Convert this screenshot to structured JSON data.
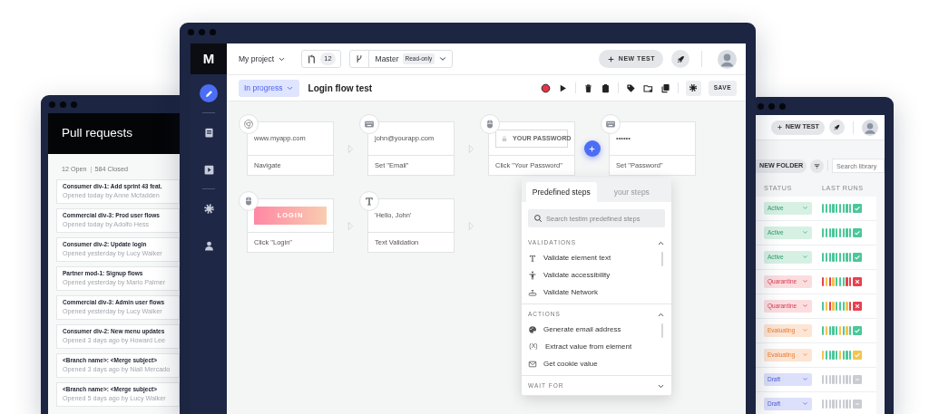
{
  "pull_requests_window": {
    "title": "Pull requests",
    "open_count": "12 Open",
    "closed_count": "584 Closed",
    "items": [
      {
        "title": "Consumer div-1: Add sprint 43 feat.",
        "meta": "Opened today by Anne Mcfadden"
      },
      {
        "title": "Commercial div-3: Prod user flows",
        "meta": "Opened today by Adolfo Hess"
      },
      {
        "title": "Consumer div-2: Update login",
        "meta": "Opened yesterday by Lucy Walker"
      },
      {
        "title": "Partner mod-1: Signup flows",
        "meta": "Opened yesterday by Mario Palmer"
      },
      {
        "title": "Commercial div-3: Admin user flows",
        "meta": "Opened yesterday by Lucy Walker"
      },
      {
        "title": "Consumer div-2: New menu updates",
        "meta": "Opened 3 days ago by Howard Lee"
      },
      {
        "title": "<Branch name>: <Merge subject>",
        "meta": "Opened 3 days ago by Niall Mercado"
      },
      {
        "title": "<Branch name>: <Merge subject>",
        "meta": "Opened 5 days ago by Lucy Walker"
      }
    ]
  },
  "main_window": {
    "logo": "M",
    "sidebar_groups": [
      {
        "items": [
          {
            "kind": "pencil",
            "selected": true
          }
        ]
      },
      {
        "items": [
          {
            "kind": "document",
            "selected": false
          },
          {
            "kind": "play",
            "selected": false
          }
        ]
      },
      {
        "items": [
          {
            "kind": "gear",
            "selected": false
          },
          {
            "kind": "user",
            "selected": false
          }
        ]
      }
    ],
    "project": "My project",
    "pr_count": "12",
    "branch": "Master",
    "branch_badge": "Read-only",
    "new_test": "NEW TEST",
    "status": "In progress",
    "test_name": "Login flow test",
    "save": "SAVE",
    "step_rows": [
      {
        "steps": [
          {
            "kind": "browser",
            "preview": {
              "kind": "text",
              "text": "www.myapp.com"
            },
            "label": "Navigate",
            "connector": {
              "kind": "arrow"
            }
          },
          {
            "kind": "keyboard",
            "preview": {
              "kind": "text",
              "text": "john@yourapp.com"
            },
            "label": "Set \"Email\"",
            "connector": {
              "kind": "arrow"
            }
          },
          {
            "kind": "mouse",
            "preview": {
              "kind": "field",
              "text": "YOUR PASSWORD"
            },
            "label": "Click \"Your Password\"",
            "connector": {
              "kind": "add"
            }
          },
          {
            "kind": "keyboard",
            "preview": {
              "kind": "text",
              "text": "••••••"
            },
            "label": "Set \"Password\""
          }
        ]
      },
      {
        "steps": [
          {
            "kind": "mouse",
            "preview": {
              "kind": "button",
              "text": "LOGIN"
            },
            "label": "Click \"Login\"",
            "connector": {
              "kind": "arrow"
            }
          },
          {
            "kind": "text",
            "preview": {
              "kind": "text",
              "text": "'Hello, John'"
            },
            "label": "Text Validation",
            "connector": {
              "kind": "arrow"
            }
          }
        ]
      }
    ],
    "step_picker": {
      "tabs": [
        {
          "label": "Predefined steps",
          "selected": true
        },
        {
          "label": "your steps",
          "selected": false
        }
      ],
      "search_placeholder": "Search testim predefined steps",
      "sections": [
        {
          "title": "VALIDATIONS",
          "expanded": true,
          "items": [
            {
              "kind": "text",
              "label": "Validate element text"
            },
            {
              "kind": "accessibility",
              "label": "Validate accessibility"
            },
            {
              "kind": "network",
              "label": "Validate Network"
            }
          ]
        },
        {
          "title": "ACTIONS",
          "expanded": true,
          "items": [
            {
              "kind": "palette",
              "label": "Generate email address"
            },
            {
              "kind": "variable",
              "icon_text": "(X)",
              "label": "Extract value from element"
            },
            {
              "kind": "mail",
              "label": "Get cookie value"
            }
          ]
        },
        {
          "title": "WAIT FOR",
          "expanded": false
        }
      ]
    }
  },
  "library_window": {
    "new_test": "NEW TEST",
    "new_folder": "NEW FOLDER",
    "search_placeholder": "Search library",
    "columns": [
      "STATUS",
      "LAST RUNS"
    ],
    "rows": [
      {
        "status": "Active",
        "kind": "active",
        "runs": [
          {
            "kind": "pass"
          },
          {
            "kind": "pass"
          },
          {
            "kind": "pass"
          },
          {
            "kind": "pass"
          },
          {
            "kind": "pass"
          },
          {
            "kind": "pass"
          },
          {
            "kind": "pass"
          },
          {
            "kind": "pass"
          },
          {
            "kind": "pass"
          }
        ],
        "result": {
          "kind": "pass"
        }
      },
      {
        "status": "Active",
        "kind": "active",
        "runs": [
          {
            "kind": "pass"
          },
          {
            "kind": "pass"
          },
          {
            "kind": "pass"
          },
          {
            "kind": "pass"
          },
          {
            "kind": "pass"
          },
          {
            "kind": "pass"
          },
          {
            "kind": "pass"
          },
          {
            "kind": "pass"
          },
          {
            "kind": "pass"
          }
        ],
        "result": {
          "kind": "pass"
        }
      },
      {
        "status": "Active",
        "kind": "active",
        "runs": [
          {
            "kind": "pass"
          },
          {
            "kind": "pass"
          },
          {
            "kind": "pass"
          },
          {
            "kind": "pass"
          },
          {
            "kind": "pass"
          },
          {
            "kind": "pass"
          },
          {
            "kind": "pass"
          },
          {
            "kind": "pass"
          },
          {
            "kind": "pass"
          }
        ],
        "result": {
          "kind": "pass"
        }
      },
      {
        "status": "Quarantine",
        "kind": "quarantine",
        "runs": [
          {
            "kind": "fail"
          },
          {
            "kind": "warn"
          },
          {
            "kind": "fail"
          },
          {
            "kind": "warn"
          },
          {
            "kind": "pass"
          },
          {
            "kind": "pass"
          },
          {
            "kind": "pass"
          },
          {
            "kind": "fail"
          },
          {
            "kind": "fail"
          }
        ],
        "result": {
          "kind": "fail"
        }
      },
      {
        "status": "Quarantine",
        "kind": "quarantine",
        "runs": [
          {
            "kind": "pass"
          },
          {
            "kind": "warn"
          },
          {
            "kind": "fail"
          },
          {
            "kind": "warn"
          },
          {
            "kind": "pass"
          },
          {
            "kind": "pass"
          },
          {
            "kind": "pass"
          },
          {
            "kind": "warn"
          },
          {
            "kind": "fail"
          }
        ],
        "result": {
          "kind": "fail"
        }
      },
      {
        "status": "Evaluating",
        "kind": "evaluating",
        "runs": [
          {
            "kind": "pass"
          },
          {
            "kind": "warn"
          },
          {
            "kind": "pass"
          },
          {
            "kind": "pass"
          },
          {
            "kind": "pass"
          },
          {
            "kind": "warn"
          },
          {
            "kind": "pass"
          },
          {
            "kind": "warn"
          },
          {
            "kind": "pass"
          }
        ],
        "result": {
          "kind": "pass"
        }
      },
      {
        "status": "Evaluating",
        "kind": "evaluating",
        "runs": [
          {
            "kind": "warn"
          },
          {
            "kind": "pass"
          },
          {
            "kind": "pass"
          },
          {
            "kind": "pass"
          },
          {
            "kind": "pass"
          },
          {
            "kind": "warn"
          },
          {
            "kind": "pass"
          },
          {
            "kind": "pass"
          },
          {
            "kind": "pass"
          }
        ],
        "result": {
          "kind": "warn"
        }
      },
      {
        "status": "Draft",
        "kind": "draft",
        "runs": [
          {
            "kind": "none"
          },
          {
            "kind": "none"
          },
          {
            "kind": "none"
          },
          {
            "kind": "none"
          },
          {
            "kind": "none"
          },
          {
            "kind": "none"
          },
          {
            "kind": "none"
          },
          {
            "kind": "none"
          },
          {
            "kind": "none"
          }
        ],
        "result": {
          "kind": "none"
        }
      },
      {
        "status": "Draft",
        "kind": "draft",
        "runs": [
          {
            "kind": "none"
          },
          {
            "kind": "none"
          },
          {
            "kind": "none"
          },
          {
            "kind": "none"
          },
          {
            "kind": "none"
          },
          {
            "kind": "none"
          },
          {
            "kind": "none"
          },
          {
            "kind": "none"
          },
          {
            "kind": "none"
          }
        ],
        "result": {
          "kind": "none"
        }
      }
    ]
  }
}
